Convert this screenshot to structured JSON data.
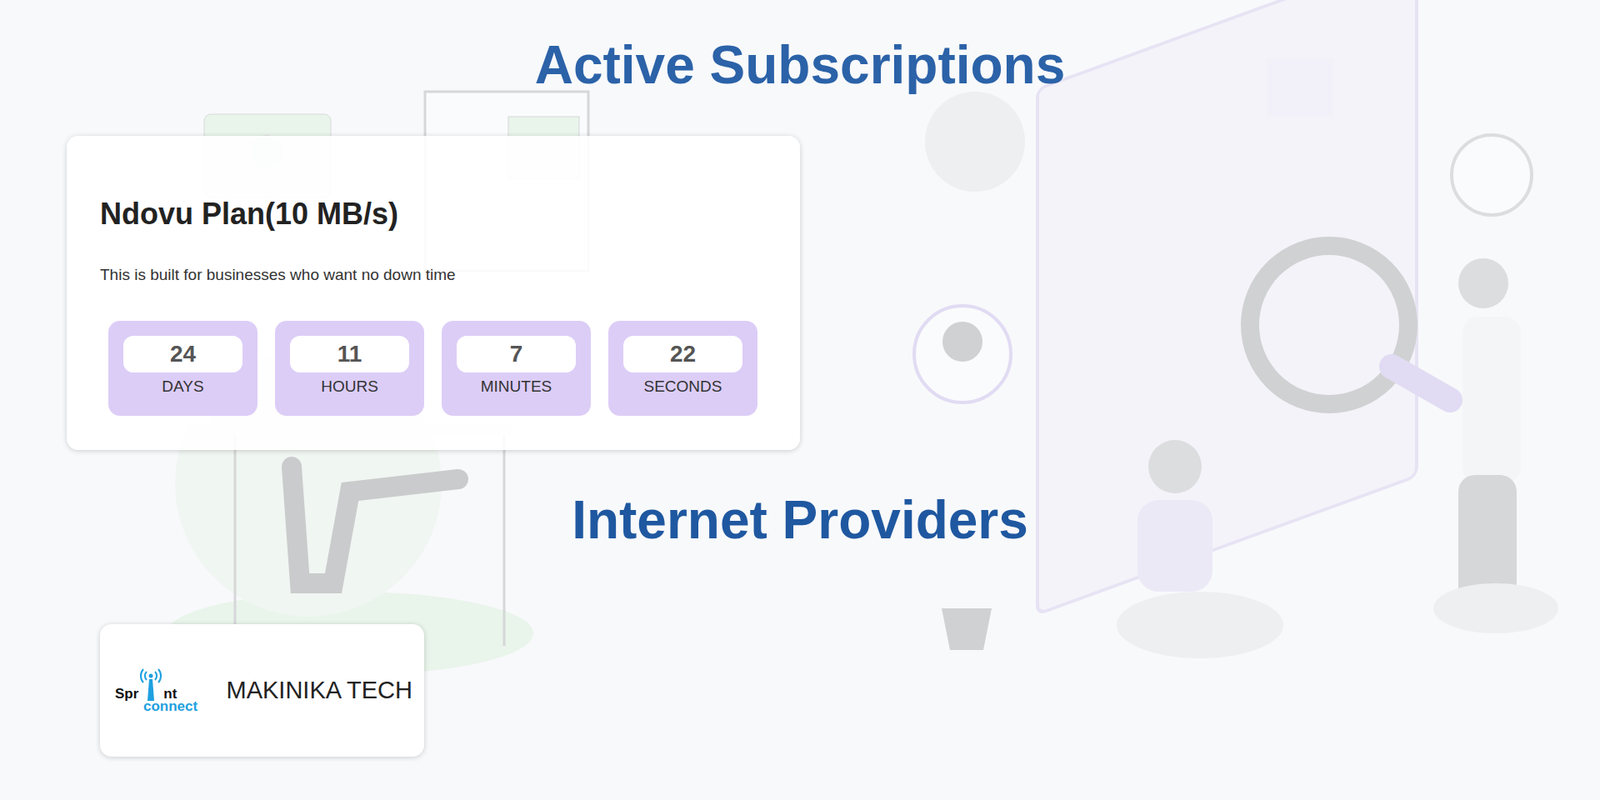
{
  "headings": {
    "subscriptions": "Active Subscriptions",
    "providers": "Internet Providers"
  },
  "subscriptions": [
    {
      "name": "Ndovu Plan(10 MB/s)",
      "description": "This is built for businesses who want no down time",
      "countdown": [
        {
          "value": "24",
          "unit": "DAYS"
        },
        {
          "value": "11",
          "unit": "HOURS"
        },
        {
          "value": "7",
          "unit": "MINUTES"
        },
        {
          "value": "22",
          "unit": "SECONDS"
        }
      ]
    }
  ],
  "providers": [
    {
      "name": "MAKINIKA TECH",
      "logo": {
        "left": "Spr",
        "right": "nt",
        "sub": "connect"
      }
    }
  ]
}
